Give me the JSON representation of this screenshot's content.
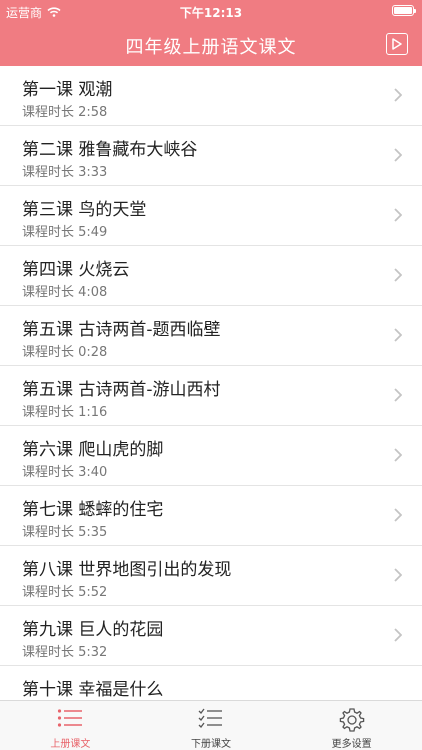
{
  "status_bar": {
    "carrier": "运营商",
    "time": "下午12:13"
  },
  "header": {
    "title": "四年级上册语文课文"
  },
  "lessons": [
    {
      "title": "第一课 观潮",
      "duration": "课程时长 2:58"
    },
    {
      "title": "第二课 雅鲁藏布大峡谷",
      "duration": "课程时长 3:33"
    },
    {
      "title": "第三课 鸟的天堂",
      "duration": "课程时长 5:49"
    },
    {
      "title": "第四课 火烧云",
      "duration": "课程时长 4:08"
    },
    {
      "title": "第五课 古诗两首-题西临壁",
      "duration": "课程时长 0:28"
    },
    {
      "title": "第五课 古诗两首-游山西村",
      "duration": "课程时长 1:16"
    },
    {
      "title": "第六课 爬山虎的脚",
      "duration": "课程时长 3:40"
    },
    {
      "title": "第七课 蟋蟀的住宅",
      "duration": "课程时长 5:35"
    },
    {
      "title": "第八课 世界地图引出的发现",
      "duration": "课程时长 5:52"
    },
    {
      "title": "第九课 巨人的花园",
      "duration": "课程时长 5:32"
    },
    {
      "title": "第十课 幸福是什么",
      "duration": ""
    }
  ],
  "tab_bar": {
    "tabs": [
      {
        "label": "上册课文",
        "icon": "list-icon",
        "active": true
      },
      {
        "label": "下册课文",
        "icon": "checklist-icon",
        "active": false
      },
      {
        "label": "更多设置",
        "icon": "gear-icon",
        "active": false
      }
    ]
  },
  "colors": {
    "accent": "#f07c82",
    "tab_active": "#e8636a"
  }
}
